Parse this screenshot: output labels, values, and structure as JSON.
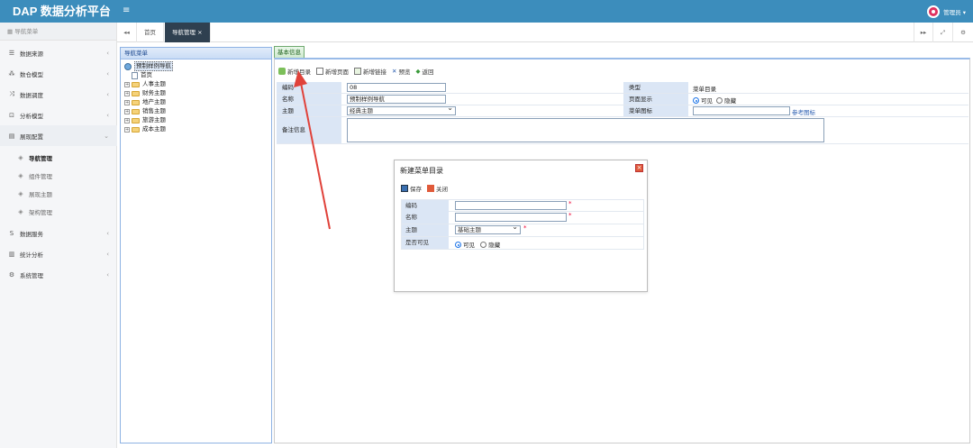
{
  "app": {
    "title": "DAP 数据分析平台",
    "menu_icon": "hamburger-icon"
  },
  "user": {
    "name": "管理员 ▾"
  },
  "sidebar": {
    "header": "导航菜单",
    "items": [
      {
        "label": "数据来源",
        "icon": "database-icon"
      },
      {
        "label": "数仓模型",
        "icon": "cubes-icon"
      },
      {
        "label": "数据调度",
        "icon": "shuffle-icon"
      },
      {
        "label": "分析模型",
        "icon": "analysis-icon"
      },
      {
        "label": "展现配置",
        "icon": "layout-icon"
      },
      {
        "label": "数据服务",
        "icon": "service-icon"
      },
      {
        "label": "统计分析",
        "icon": "bar-chart-icon"
      },
      {
        "label": "系统管理",
        "icon": "gear-icon"
      }
    ],
    "sub_items": [
      {
        "label": "导航管理"
      },
      {
        "label": "组件管理"
      },
      {
        "label": "展现主题"
      },
      {
        "label": "架构管理"
      }
    ]
  },
  "tabs": {
    "prev": "◂◂",
    "next": "▸▸",
    "expand": "⤢",
    "settings": "⚙",
    "items": [
      {
        "label": "首页"
      },
      {
        "label": "导航管理 ×"
      }
    ]
  },
  "nav_panel": {
    "title": "导航菜单",
    "tree": [
      {
        "label": "预制样例导航",
        "type": "root"
      },
      {
        "label": "首页",
        "type": "page"
      },
      {
        "label": "人事主题",
        "type": "folder"
      },
      {
        "label": "财务主题",
        "type": "folder"
      },
      {
        "label": "地产主题",
        "type": "folder"
      },
      {
        "label": "销售主题",
        "type": "folder"
      },
      {
        "label": "旅游主题",
        "type": "folder"
      },
      {
        "label": "成本主题",
        "type": "folder"
      }
    ]
  },
  "main": {
    "tab_label": "基本信息",
    "toolbar": {
      "new_dir": "新增目录",
      "new_page": "新增页面",
      "new_link": "新增链接",
      "preview": "预览",
      "back": "返回"
    },
    "form": {
      "code_label": "编码",
      "code_value": "08",
      "name_label": "名称",
      "name_value": "预制样例导航",
      "theme_label": "主题",
      "theme_value": "经典主题",
      "remark_label": "备注信息",
      "type_label": "类型",
      "type_value": "菜单目录",
      "display_label": "页面显示",
      "visible_label": "可见",
      "hidden_label": "隐藏",
      "menu_icon_label": "菜单图标",
      "ref_icon_link": "参考图标"
    }
  },
  "dialog": {
    "title": "新建菜单目录",
    "close": "×",
    "save_label": "保存",
    "close_label": "关闭",
    "code_label": "编码",
    "name_label": "名称",
    "theme_label": "主题",
    "theme_value": "基础主题",
    "visible_q_label": "是否可见",
    "visible_label": "可见",
    "hidden_label": "隐藏",
    "required_mark": "*"
  },
  "colors": {
    "brand": "#3c8dbc",
    "active_tab": "#2f4050",
    "arrow": "#e0423a"
  }
}
